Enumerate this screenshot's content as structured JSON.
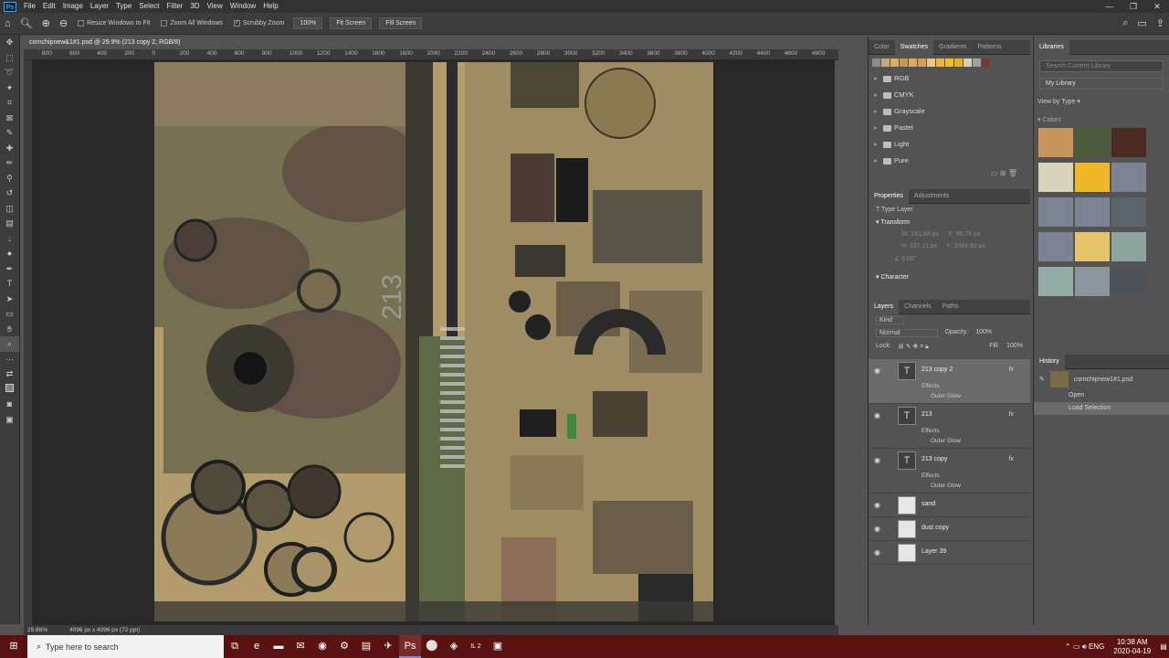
{
  "app": {
    "logo": "Ps"
  },
  "menu": [
    "File",
    "Edit",
    "Image",
    "Layer",
    "Type",
    "Select",
    "Filter",
    "3D",
    "View",
    "Window",
    "Help"
  ],
  "options": {
    "resize_windows": "Resize Windows to Fit",
    "zoom_all": "Zoom All Windows",
    "scrubby_zoom": "Scrubby Zoom",
    "zoom_value": "100%",
    "fit_screen": "Fit Screen",
    "fill_screen": "Fill Screen"
  },
  "document": {
    "tab_title": "cornchipnew&1#1.psd @ 29.9% (213 copy 2, RGB/8)",
    "zoom": "29.86%",
    "size_info": "4096 px x 4096 px (72 ppi)"
  },
  "ruler_labels": [
    "800",
    "600",
    "400",
    "200",
    "0",
    "200",
    "400",
    "600",
    "800",
    "1000",
    "1200",
    "1400",
    "1600",
    "1800",
    "2000",
    "2200",
    "2400",
    "2600",
    "2800",
    "3000",
    "3200",
    "3400",
    "3600",
    "3800",
    "4000",
    "4200",
    "4400",
    "4600",
    "4800"
  ],
  "swatches_panel": {
    "tabs": [
      "Color",
      "Swatches",
      "Gradients",
      "Patterns"
    ],
    "active_tab": "Swatches",
    "colors": [
      "#8c8c8c",
      "#c8a878",
      "#d4b06a",
      "#c89a4c",
      "#e0a860",
      "#d4a050",
      "#e8c880",
      "#e8b830",
      "#f0c020",
      "#e8b020",
      "#d8d0b8",
      "#a0a0a0",
      "#7a3828"
    ],
    "folders": [
      "RGB",
      "CMYK",
      "Grayscale",
      "Pastel",
      "Light",
      "Pure"
    ]
  },
  "properties_panel": {
    "tabs": [
      "Properties",
      "Adjustments"
    ],
    "type_label": "Type Layer",
    "transform_label": "Transform",
    "w": "W: 241.84 px",
    "x": "X: 96.76 px",
    "h": "H: 237.11 px",
    "y": "Y: 1044.82 px",
    "angle": "0.00°",
    "character_label": "Character"
  },
  "layers_panel": {
    "tabs": [
      "Layers",
      "Channels",
      "Paths"
    ],
    "kind": "Kind",
    "blend_mode": "Normal",
    "opacity_label": "Opacity:",
    "opacity": "100%",
    "lock_label": "Lock:",
    "fill_label": "Fill:",
    "fill": "100%",
    "layers": [
      {
        "name": "213 copy 2",
        "type": "T",
        "effects": "Effects",
        "effect": "Outer Glow",
        "selected": true
      },
      {
        "name": "213",
        "type": "T",
        "effects": "Effects",
        "effect": "Outer Glow"
      },
      {
        "name": "213 copy",
        "type": "T",
        "effects": "Effects",
        "effect": "Outer Glow"
      },
      {
        "name": "sand",
        "type": "img"
      },
      {
        "name": "dust copy",
        "type": "img"
      },
      {
        "name": "Layer 39",
        "type": "img"
      }
    ]
  },
  "libraries_panel": {
    "tab": "Libraries",
    "search_placeholder": "Search Current Library",
    "library": "My Library",
    "view_by": "View by Type",
    "colors_label": "Colors",
    "colors": [
      "#c8965a",
      "#4c5a3c",
      "#4a2a22",
      "#d8d4bc",
      "#f0b828",
      "#7c8494",
      "#7c8494",
      "#7c8494",
      "#5c646c",
      "#7c8494",
      "#e6c46c",
      "#8ca4a0",
      "#94aca8",
      "#8c949c",
      "#4c5258"
    ]
  },
  "history_panel": {
    "tab": "History",
    "snapshot": "cornchipnew1#1.psd",
    "items": [
      "Open",
      "Load Selection"
    ]
  },
  "taskbar": {
    "search_placeholder": "Type here to search",
    "lang": "ENG",
    "time": "10:38 AM",
    "date": "2020-04-19",
    "il2": "IL 2"
  }
}
